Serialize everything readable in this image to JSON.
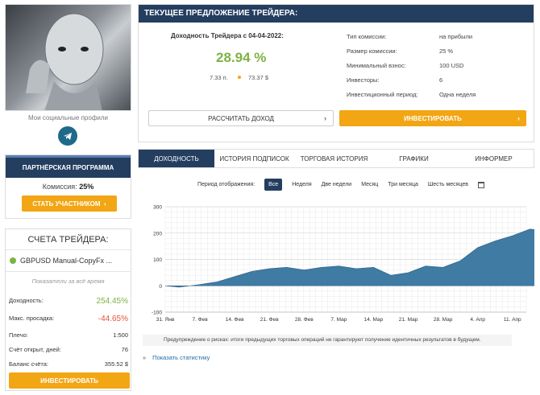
{
  "profile": {
    "socials_label": "Мои социальные профили"
  },
  "partner": {
    "title": "ПАРТНЁРСКАЯ ПРОГРАММА",
    "commission_label": "Комиссия:",
    "commission_value": "25%",
    "button": "СТАТЬ УЧАСТНИКОМ"
  },
  "accounts": {
    "title": "СЧЕТА ТРЕЙДЕРА:",
    "account_name": "GBPUSD Manual-CopyFx ...",
    "note": "Показатели за всё время",
    "stats": [
      {
        "label": "Доходность:",
        "value": "254.45%"
      },
      {
        "label": "Макс. просадка:",
        "value": "-44.65%"
      },
      {
        "label": "Плечо:",
        "value": "1:500"
      },
      {
        "label": "Счёт открыт, дней:",
        "value": "76"
      },
      {
        "label": "Баланс счёта:",
        "value": "355.52 $"
      }
    ],
    "invest_button": "ИНВЕСТИРОВАТЬ"
  },
  "offer": {
    "title": "ТЕКУЩЕЕ ПРЕДЛОЖЕНИЕ ТРЕЙДЕРА:",
    "rate_label": "Доходность Трейдера с 04-04-2022:",
    "rate_value": "28.94 %",
    "points": "7.33 п.",
    "usd": "73.37 $",
    "details": [
      {
        "label": "Тип комиссии:",
        "value": "на прибыли"
      },
      {
        "label": "Размер комиссии:",
        "value": "25 %"
      },
      {
        "label": "Минимальный взнос:",
        "value": "100 USD"
      },
      {
        "label": "Инвесторы:",
        "value": "6"
      },
      {
        "label": "Инвестиционный период:",
        "value": "Одна неделя"
      }
    ],
    "calc_button": "РАССЧИТАТЬ ДОХОД",
    "invest_button": "ИНВЕСТИРОВАТЬ"
  },
  "tabs": [
    "ДОХОДНОСТЬ",
    "ИСТОРИЯ ПОДПИСОК",
    "ТОРГОВАЯ ИСТОРИЯ",
    "ГРАФИКИ",
    "ИНФОРМЕР"
  ],
  "periods": {
    "label": "Период отображения:",
    "options": [
      "Все",
      "Неделя",
      "Две недели",
      "Месяц",
      "Три месяца",
      "Шесть месяцев"
    ]
  },
  "warning": "Предупреждение о рисках: итоги предыдущих торговых операций не гарантируют получение идентичных результатов в будущем.",
  "show_stats": "Показать статистику",
  "colors": {
    "navy": "#243e60",
    "accent": "#f2a614",
    "green": "#7cb342",
    "red": "#e5533d",
    "area": "#3f7ba3"
  },
  "chart_data": {
    "type": "area",
    "x_ticks": [
      "31. Янв",
      "7. Фев",
      "14. Фев",
      "21. Фев",
      "28. Фев",
      "7. Мар",
      "14. Мар",
      "21. Мар",
      "28. Мар",
      "4. Апр",
      "11. Апр"
    ],
    "ylim": [
      -100,
      300
    ],
    "y_ticks": [
      -100,
      0,
      100,
      200,
      300
    ],
    "grid": true,
    "x": [
      0,
      0.4,
      1,
      1.5,
      2,
      2.5,
      3,
      3.5,
      4,
      4.5,
      5,
      5.5,
      6,
      6.5,
      7,
      7.5,
      8,
      8.5,
      9,
      9.5,
      10,
      10.5,
      11,
      11.3
    ],
    "values": [
      0,
      -5,
      5,
      15,
      35,
      55,
      65,
      70,
      60,
      70,
      75,
      65,
      70,
      40,
      50,
      75,
      70,
      95,
      145,
      170,
      190,
      215,
      210,
      255
    ]
  }
}
